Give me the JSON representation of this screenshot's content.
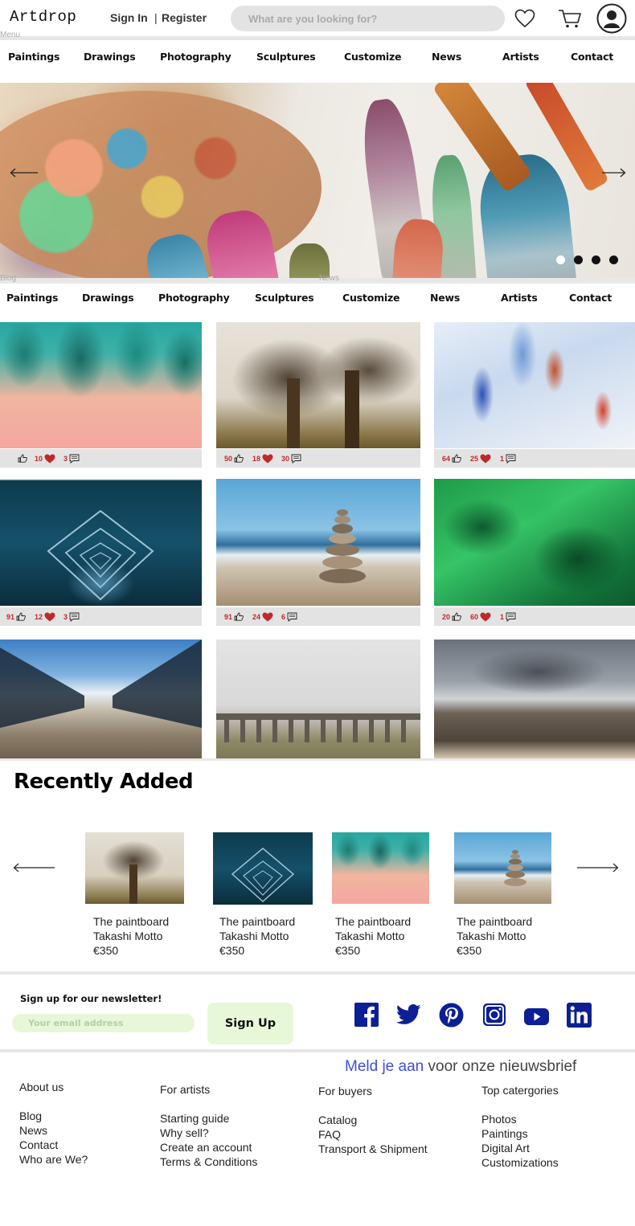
{
  "header": {
    "logo": "Artdrop",
    "sign_in": "Sign In",
    "register_separator": "|",
    "register": "Register",
    "search_placeholder": "What are you looking for?",
    "menu_label": "Menu"
  },
  "nav": {
    "items": [
      "Paintings",
      "Drawings",
      "Photography",
      "Sculptures",
      "Customize",
      "News",
      "Artists",
      "Contact"
    ]
  },
  "hero": {
    "prev_icon": "left-arrow-icon",
    "next_icon": "right-arrow-icon",
    "slides": 4,
    "active_slide": 1
  },
  "subnav": {
    "blog_label": "Blog",
    "news_label": "News",
    "items": [
      "Paintings",
      "Drawings",
      "Photography",
      "Sculptures",
      "Customize",
      "News",
      "Artists",
      "Contact"
    ]
  },
  "gallery": {
    "tiles": [
      {
        "likes": "",
        "hearts": "10",
        "comments": "3"
      },
      {
        "likes": "50",
        "hearts": "18",
        "comments": "30"
      },
      {
        "likes": "64",
        "hearts": "25",
        "comments": "1"
      },
      {
        "likes": "91",
        "hearts": "12",
        "comments": "3"
      },
      {
        "likes": "91",
        "hearts": "24",
        "comments": "6"
      },
      {
        "likes": "20",
        "hearts": "60",
        "comments": "1"
      }
    ]
  },
  "recent": {
    "title": "Recently Added",
    "cards": [
      {
        "title": "The paintboard",
        "artist": "Takashi Motto",
        "price": "€350"
      },
      {
        "title": "The paintboard",
        "artist": "Takashi Motto",
        "price": "€350"
      },
      {
        "title": "The paintboard",
        "artist": "Takashi Motto",
        "price": "€350"
      },
      {
        "title": "The paintboard",
        "artist": "Takashi Motto",
        "price": "€350"
      }
    ]
  },
  "newsletter": {
    "title": "Sign up for our newsletter!",
    "email_placeholder": "Your email address",
    "button": "Sign Up",
    "social": [
      "facebook-icon",
      "twitter-icon",
      "pinterest-icon",
      "instagram-icon",
      "youtube-icon",
      "linkedin-icon"
    ],
    "brand_color": "#0d1f94"
  },
  "footer": {
    "meld_link": "Meld je aan",
    "meld_rest": " voor onze nieuwsbrief",
    "columns": [
      {
        "head": "About us",
        "items": [
          "Blog",
          "News",
          "Contact",
          "Who are We?"
        ]
      },
      {
        "head": "For artists",
        "items": [
          "Starting guide",
          "Why sell?",
          "Create an account",
          "Terms & Conditions"
        ]
      },
      {
        "head": "For buyers",
        "items": [
          "Catalog",
          "FAQ",
          "Transport & Shipment"
        ]
      },
      {
        "head": "Top catergories",
        "items": [
          "Photos",
          "Paintings",
          "Digital Art",
          "Customizations"
        ]
      }
    ]
  }
}
